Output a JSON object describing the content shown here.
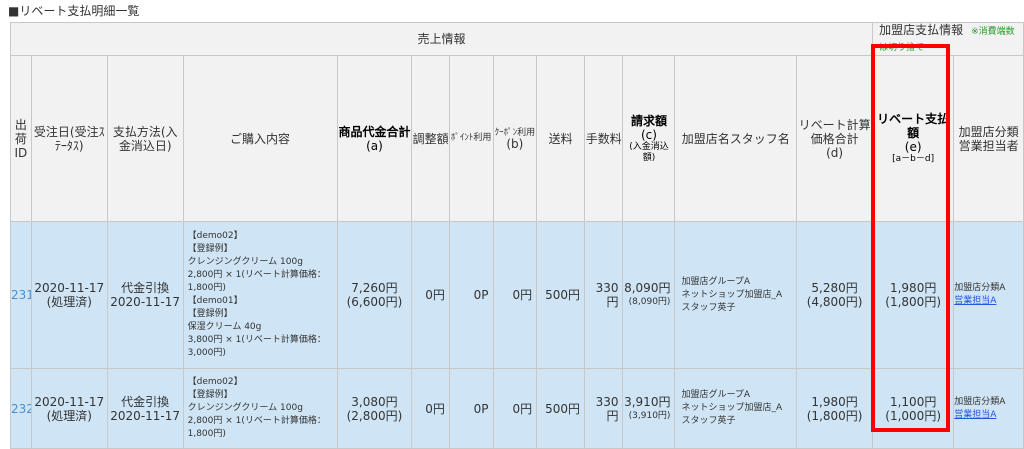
{
  "page_title": "■リベート支払明細一覧",
  "group_headers": {
    "sales": "売上情報",
    "shop_payment": "加盟店支払情報",
    "tax_note": "※消費端数は切り捨て"
  },
  "columns": {
    "id": "出荷ID",
    "date": "受注日(受注ｽﾃｰﾀｽ)",
    "pay": "支払方法(入金消込日)",
    "content": "ご購入内容",
    "total": "商品代金合計",
    "total_sub": "(a)",
    "adjust": "調整額",
    "point": "ﾎﾟｲﾝﾄ利用",
    "coupon": "ｸｰﾎﾟﾝ利用",
    "coupon_sub": "(b)",
    "ship": "送料",
    "fee": "手数料",
    "billing": "請求額",
    "billing_sub": "(c)",
    "billing_sub2": "(入金消込額)",
    "shop": "加盟店名スタッフ名",
    "rebate_base": "リベート計算価格合計",
    "rebate_base_sub": "(d)",
    "rebate_pay": "リベート支払額",
    "rebate_pay_sub": "(e)",
    "rebate_pay_sub2": "[a－b－d]",
    "category": "加盟店分類営業担当者"
  },
  "rows": [
    {
      "id": "231",
      "date": "2020-11-17",
      "status": "(処理済)",
      "pay_method": "代金引換",
      "pay_date": "2020-11-17",
      "items": [
        "【demo02】",
        "【登録例】",
        "クレンジングクリーム 100g",
        "2,800円 × 1(リベート計算価格：1,800円)",
        "【demo01】",
        "【登録例】",
        "保湿クリーム 40g",
        "3,800円 × 1(リベート計算価格：3,000円)"
      ],
      "total": "7,260円",
      "total_sub": "(6,600円)",
      "adjust": "0円",
      "point": "0P",
      "coupon": "0円",
      "ship": "500円",
      "fee": "330円",
      "billing": "8,090円",
      "billing_sub": "(8,090円)",
      "shop_group": "加盟店グループA",
      "shop_name": "ネットショップ加盟店_A",
      "staff": "スタッフ英子",
      "rebate_base": "5,280円",
      "rebate_base_sub": "(4,800円)",
      "rebate_pay": "1,980円",
      "rebate_pay_sub": "(1,800円)",
      "category": "加盟店分類A",
      "sales_rep": "営業担当A"
    },
    {
      "id": "232",
      "date": "2020-11-17",
      "status": "(処理済)",
      "pay_method": "代金引換",
      "pay_date": "2020-11-17",
      "items": [
        "【demo02】",
        "【登録例】",
        "クレンジングクリーム 100g",
        "2,800円 × 1(リベート計算価格：1,800円)"
      ],
      "total": "3,080円",
      "total_sub": "(2,800円)",
      "adjust": "0円",
      "point": "0P",
      "coupon": "0円",
      "ship": "500円",
      "fee": "330円",
      "billing": "3,910円",
      "billing_sub": "(3,910円)",
      "shop_group": "加盟店グループA",
      "shop_name": "ネットショップ加盟店_A",
      "staff": "スタッフ英子",
      "rebate_base": "1,980円",
      "rebate_base_sub": "(1,800円)",
      "rebate_pay": "1,100円",
      "rebate_pay_sub": "(1,000円)",
      "category": "加盟店分類A",
      "sales_rep": "営業担当A"
    }
  ],
  "highlight_color": "#ff0000"
}
